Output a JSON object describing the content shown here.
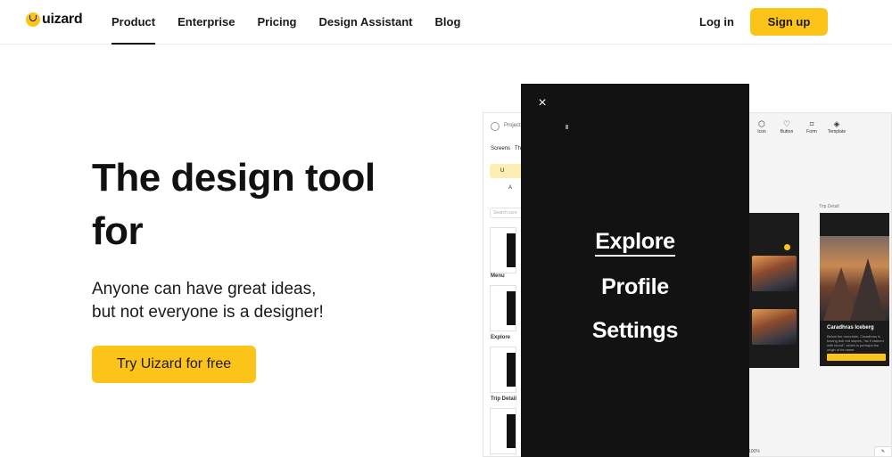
{
  "nav": {
    "logo_text": "uizard",
    "links": [
      "Product",
      "Enterprise",
      "Pricing",
      "Design Assistant",
      "Blog"
    ],
    "active_link": "Product",
    "login": "Log in",
    "signup": "Sign up"
  },
  "hero": {
    "title_line1": "The design tool",
    "title_line2": "for",
    "sub_line1": "Anyone can have great ideas,",
    "sub_line2": "but not everyone is a designer!",
    "cta": "Try Uizard for free"
  },
  "editor": {
    "project_label": "Project",
    "tab_screens": "Screens",
    "tab_themes": "Th",
    "upload_label": "U",
    "add_label": "A",
    "search_placeholder": "Search scre",
    "sections": [
      "Menu",
      "Explore",
      "Trip Detail"
    ],
    "toolbar": [
      "Icon",
      "Button",
      "Form",
      "Template"
    ],
    "trip_label": "Trip Detail",
    "card_title": "Caradhras Iceberg",
    "card_text": "Below the mountain, Caradhras is having dull red slopes, \"as if stained with blood\", which is perhaps the origin of its name",
    "zoom": "100%"
  },
  "overlay": {
    "close": "×",
    "items": [
      "Explore",
      "Profile",
      "Settings"
    ],
    "current": "Explore"
  },
  "colors": {
    "accent": "#fcc419",
    "overlay_bg": "#121212"
  }
}
